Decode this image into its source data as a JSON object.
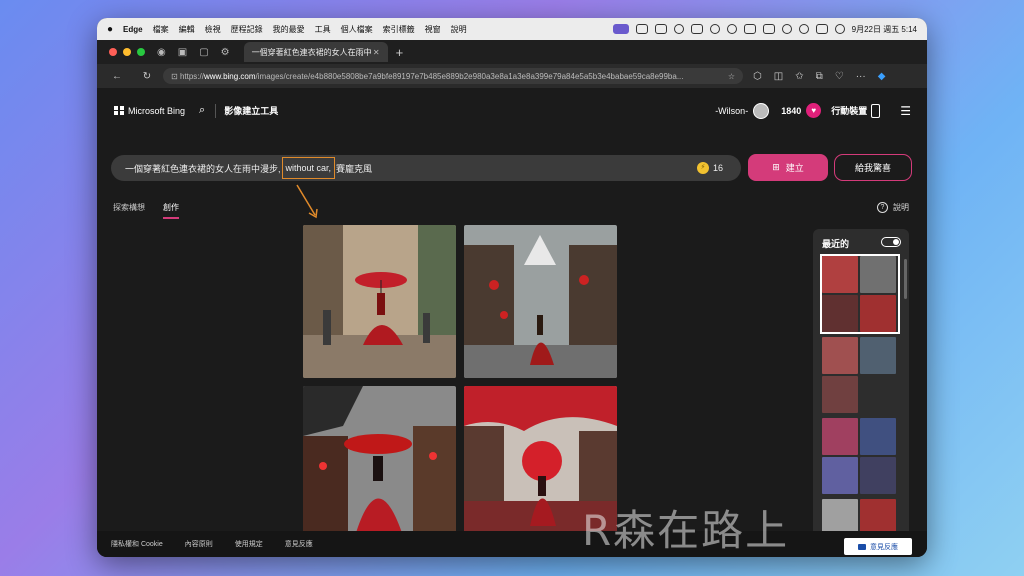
{
  "menubar": {
    "app": "Edge",
    "items": [
      "檔案",
      "編輯",
      "檢視",
      "歷程記錄",
      "我的最愛",
      "工具",
      "個人檔案",
      "索引標籤",
      "視窗",
      "說明"
    ],
    "clock": "9月22日 週五 5:14"
  },
  "tab": {
    "title": "一個穿著紅色連衣裙的女人在雨中"
  },
  "address": {
    "prefix": "https://",
    "host": "www.bing.com",
    "path": "/images/create/e4b880e5808be7a9bfe89197e7b485e889b2e980a3e8a1a3e8a399e79a84e5a5b3e4babae59ca8e99ba..."
  },
  "header": {
    "brand": "Microsoft Bing",
    "tool": "影像建立工具",
    "user": "-Wilson-",
    "points": "1840",
    "mobile": "行動裝置"
  },
  "prompt": {
    "text_before": "一個穿著紅色連衣裙的女人在雨中漫步,",
    "highlight": "without car,",
    "text_after": "賽龐克風",
    "boosts": "16"
  },
  "buttons": {
    "create": "建立",
    "surprise": "給我驚喜"
  },
  "subtabs": {
    "explore": "探索構想",
    "create": "創作",
    "help": "說明"
  },
  "recent": {
    "title": "最近的"
  },
  "footer": {
    "links": [
      "隱私權和 Cookie",
      "內容原則",
      "使用規定",
      "意見反應"
    ],
    "feedback": "意見反應"
  },
  "watermark": "R森在路上",
  "colors": {
    "accent": "#d43b7a",
    "highlight_box": "#e08a2a"
  }
}
